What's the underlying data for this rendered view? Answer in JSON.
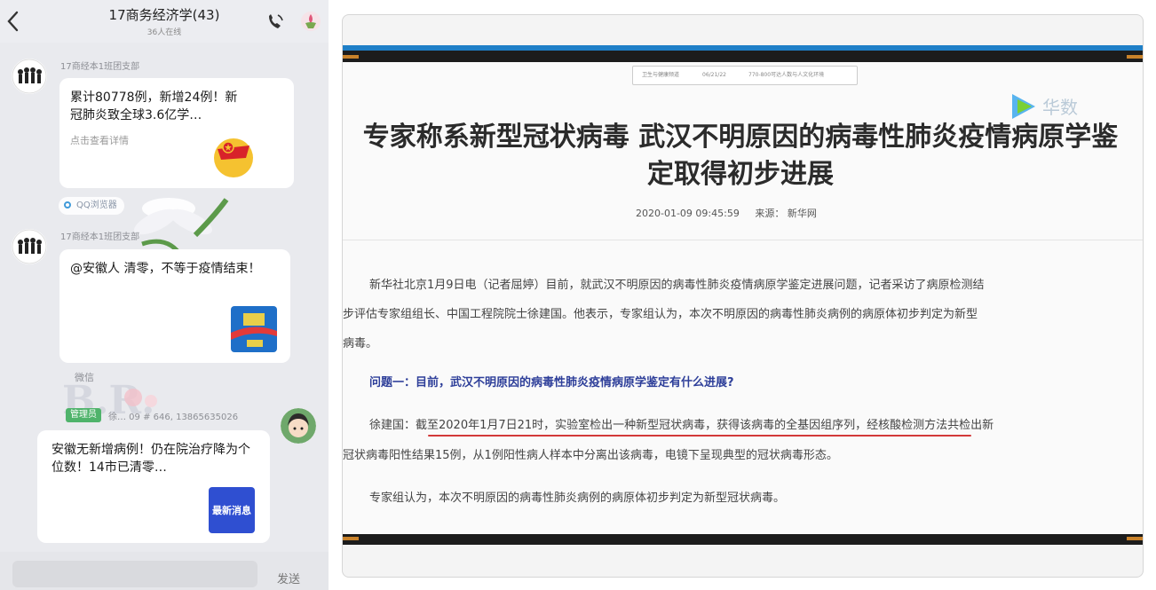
{
  "chat": {
    "group_title": "17商务经济学(43)",
    "online_count": "36人在线",
    "messages": [
      {
        "sender": "17商经本1班团支部",
        "card_title": "累计80778例，新增24例！新冠肺炎致全球3.6亿学…",
        "card_sub": "点击查看详情"
      },
      {
        "source_tag": "QQ浏览器",
        "sender": "17商经本1班团支部",
        "card_title": "@安徽人 清零，不等于疫情结束！",
        "card_sub": "微信"
      },
      {
        "role_badge": "管理员",
        "sender": "徐… 09 # 646, 13865635026",
        "card_title": "安徽无新增病例！仍在院治疗降为个位数！14市已清零…",
        "thumb_text": "最新消息"
      }
    ],
    "send_label": "发送"
  },
  "video": {
    "nav_items": [
      "卫生与健康频道",
      "06/21/22",
      "770-800可达人数与人文化环境"
    ],
    "logo_text": "华数",
    "title_line1": "专家称系新型冠状病毒 武汉不明原因的病毒性肺炎疫情病原学鉴",
    "title_line2": "定取得初步进展",
    "meta_time": "2020-01-09 09:45:59",
    "meta_source": "来源：  新华网",
    "para1_line1": "新华社北京1月9日电（记者屈婷）目前，就武汉不明原因的病毒性肺炎疫情病原学鉴定进展问题，记者采访了病原检测结",
    "para1_line2": "步评估专家组组长、中国工程院院士徐建国。他表示，专家组认为，本次不明原因的病毒性肺炎病例的病原体初步判定为新型",
    "para1_line3": "病毒。",
    "q1": "问题一：目前，武汉不明原因的病毒性肺炎疫情病原学鉴定有什么进展?",
    "answer_line1": "徐建国：截至2020年1月7日21时，实验室检出一种新型冠状病毒，获得该病毒的全基因组序列，经核酸检测方法共检出新",
    "answer_line2": "冠状病毒阳性结果15例，从1例阳性病人样本中分离出该病毒，电镜下呈现典型的冠状病毒形态。",
    "para3": "专家组认为，本次不明原因的病毒性肺炎病例的病原体初步判定为新型冠状病毒。"
  },
  "colors": {
    "underline": "#d33a3a",
    "question": "#2d3e99",
    "top_bar": "#1f7fc7",
    "admin_badge": "#4fb36b"
  }
}
